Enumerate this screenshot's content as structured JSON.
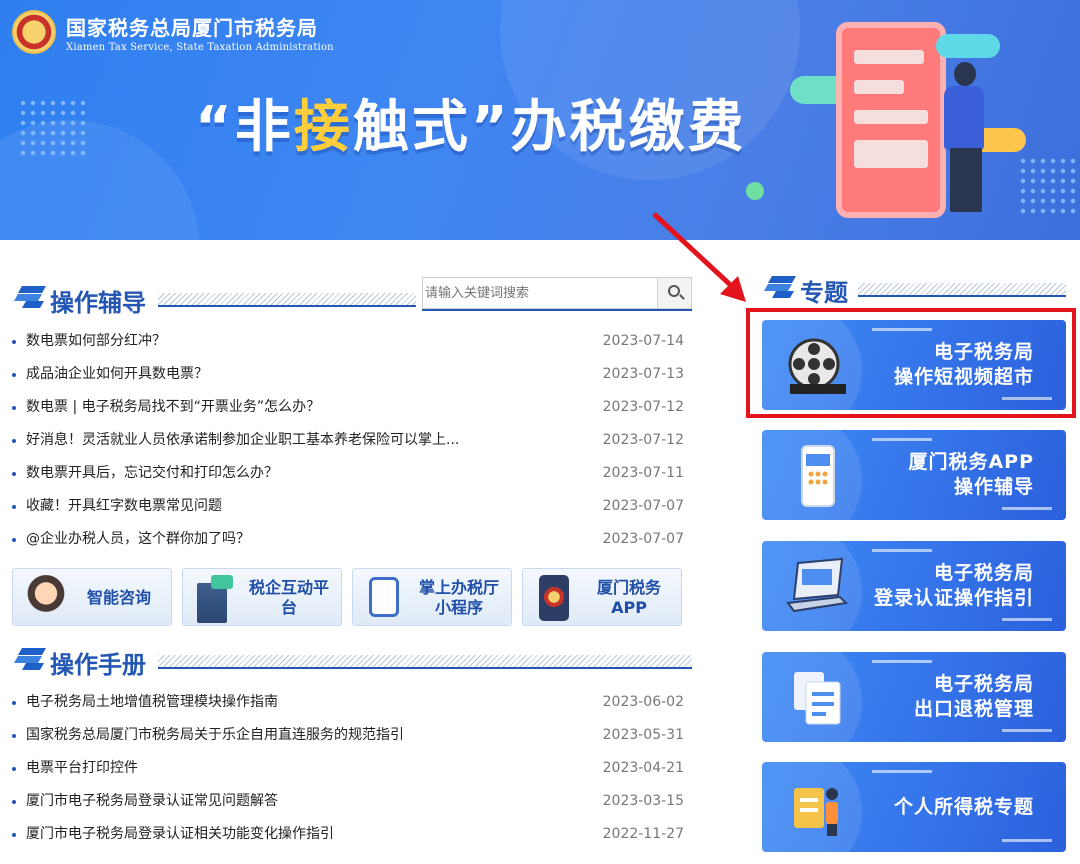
{
  "header": {
    "org_name": "国家税务总局厦门市税务局",
    "org_name_en": "Xiamen Tax Service, State Taxation Administration",
    "slogan_part1": "“非",
    "slogan_highlight": "接",
    "slogan_part2": "触式”办税缴费"
  },
  "guide": {
    "title": "操作辅导",
    "search_placeholder": "请输入关键词搜索",
    "items": [
      {
        "title": "数电票如何部分红冲？",
        "date": "2023-07-14"
      },
      {
        "title": "成品油企业如何开具数电票？",
        "date": "2023-07-13"
      },
      {
        "title": "数电票 | 电子税务局找不到“开票业务”怎么办？",
        "date": "2023-07-12"
      },
      {
        "title": "好消息！灵活就业人员依承诺制参加企业职工基本养老保险可以掌上...",
        "date": "2023-07-12"
      },
      {
        "title": "数电票开具后，忘记交付和打印怎么办？",
        "date": "2023-07-11"
      },
      {
        "title": "收藏！开具红字数电票常见问题",
        "date": "2023-07-07"
      },
      {
        "title": "@企业办税人员，这个群你加了吗？",
        "date": "2023-07-07"
      }
    ]
  },
  "quick_links": [
    {
      "label": "智能咨询",
      "icon": "customer-service-icon"
    },
    {
      "label": "税企互动平台",
      "icon": "chat-building-icon"
    },
    {
      "label": "掌上办税厅\n小程序",
      "label1": "掌上办税厅",
      "label2": "小程序",
      "icon": "mobile-hall-icon"
    },
    {
      "label": "厦门税务APP",
      "icon": "tax-app-icon"
    }
  ],
  "manual": {
    "title": "操作手册",
    "items": [
      {
        "title": "电子税务局土地增值税管理模块操作指南",
        "date": "2023-06-02"
      },
      {
        "title": "国家税务总局厦门市税务局关于乐企自用直连服务的规范指引",
        "date": "2023-05-31"
      },
      {
        "title": "电票平台打印控件",
        "date": "2023-04-21"
      },
      {
        "title": "厦门市电子税务局登录认证常见问题解答",
        "date": "2023-03-15"
      },
      {
        "title": "厦门市电子税务局登录认证相关功能变化操作指引",
        "date": "2022-11-27"
      }
    ]
  },
  "topics": {
    "title": "专题",
    "cards": [
      {
        "line1": "电子税务局",
        "line2": "操作短视频超市",
        "icon": "film-reel-icon",
        "highlighted": true
      },
      {
        "line1": "厦门税务APP",
        "line2": "操作辅导",
        "icon": "smartphone-icon",
        "highlighted": false
      },
      {
        "line1": "电子税务局",
        "line2": "登录认证操作指引",
        "icon": "laptop-icon",
        "highlighted": false
      },
      {
        "line1": "电子税务局",
        "line2": "出口退税管理",
        "icon": "documents-icon",
        "highlighted": false
      },
      {
        "line1": "个人所得税专题",
        "line2": "",
        "icon": "person-card-icon",
        "highlighted": false
      }
    ]
  },
  "colors": {
    "brand_blue": "#2456b4",
    "highlight_red": "#e3141b",
    "slogan_accent": "#ffce3a"
  }
}
